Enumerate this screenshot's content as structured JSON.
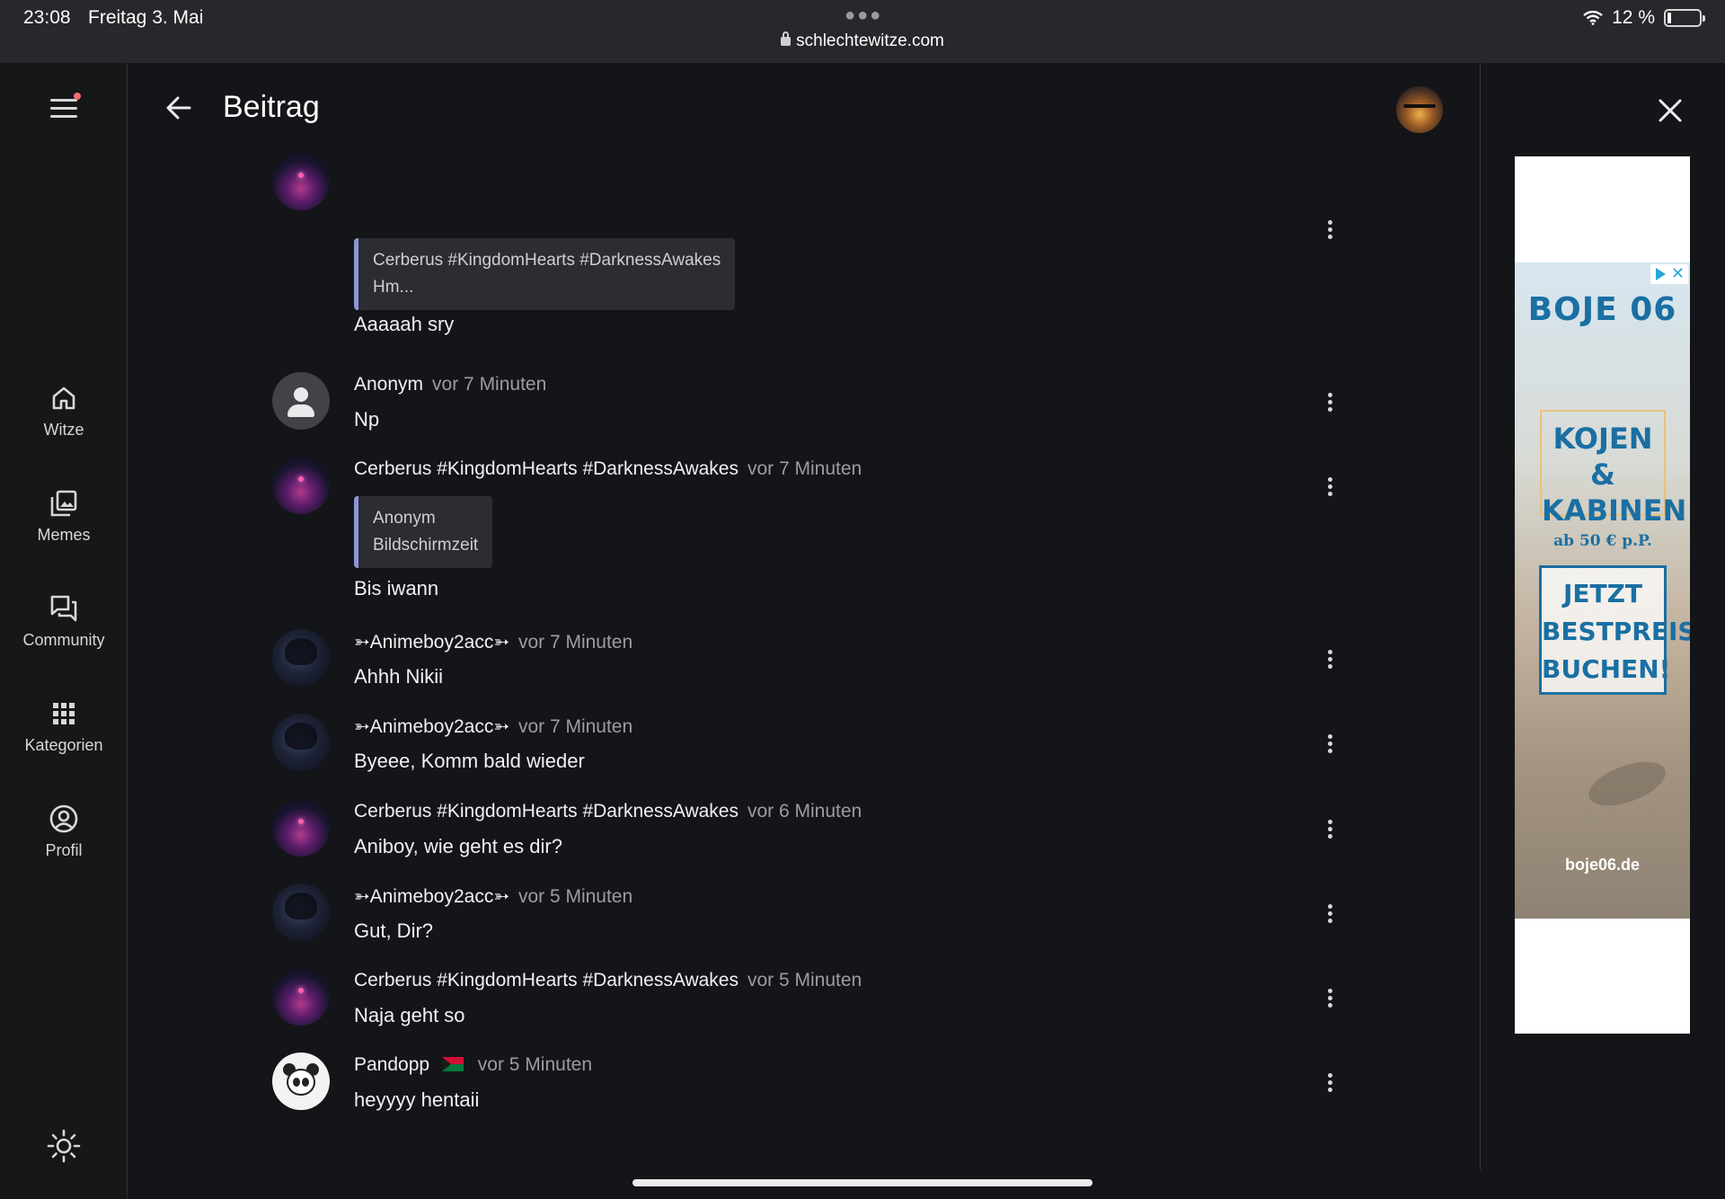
{
  "status_bar": {
    "time": "23:08",
    "date": "Freitag 3. Mai",
    "url": "schlechtewitze.com",
    "battery": "12 %"
  },
  "sidebar": {
    "items": [
      {
        "label": "Witze",
        "icon": "home-icon"
      },
      {
        "label": "Memes",
        "icon": "image-gallery-icon"
      },
      {
        "label": "Community",
        "icon": "chat-bubbles-icon"
      },
      {
        "label": "Kategorien",
        "icon": "grid-icon"
      },
      {
        "label": "Profil",
        "icon": "account-circle-icon"
      }
    ]
  },
  "header": {
    "title": "Beitrag"
  },
  "comments": [
    {
      "author": "",
      "time": "",
      "quote_author": "Cerberus #KingdomHearts #DarknessAwakes",
      "quote_text": "Hm...",
      "text": "Aaaaah sry"
    },
    {
      "author": "Anonym",
      "time": "vor 7 Minuten",
      "text": "Np"
    },
    {
      "author": "Cerberus #KingdomHearts #DarknessAwakes",
      "time": "vor 7 Minuten",
      "quote_author": "Anonym",
      "quote_text": "Bildschirmzeit",
      "text": "Bis iwann"
    },
    {
      "author": "➳Animeboy2acc➳",
      "time": "vor 7 Minuten",
      "text": "Ahhh Nikii"
    },
    {
      "author": "➳Animeboy2acc➳",
      "time": "vor 7 Minuten",
      "text": "Byeee, Komm bald wieder"
    },
    {
      "author": "Cerberus #KingdomHearts #DarknessAwakes",
      "time": "vor 6 Minuten",
      "text": "Aniboy, wie geht es dir?"
    },
    {
      "author": "➳Animeboy2acc➳",
      "time": "vor 5 Minuten",
      "text": "Gut, Dir?"
    },
    {
      "author": "Cerberus #KingdomHearts #DarknessAwakes",
      "time": "vor 5 Minuten",
      "text": "Naja geht so"
    },
    {
      "author": "Pandopp",
      "time": "vor 5 Minuten",
      "text": "heyyyy hentaii"
    }
  ],
  "ad": {
    "brand": "BOJE 06",
    "headline": "KOJEN & KABINEN",
    "price": "ab 50 € p.P.",
    "cta": "JETZT BESTPREIS BUCHEN!",
    "url": "boje06.de",
    "colors": {
      "brand": "#1a6fa3",
      "accent": "#e8c27a"
    }
  }
}
